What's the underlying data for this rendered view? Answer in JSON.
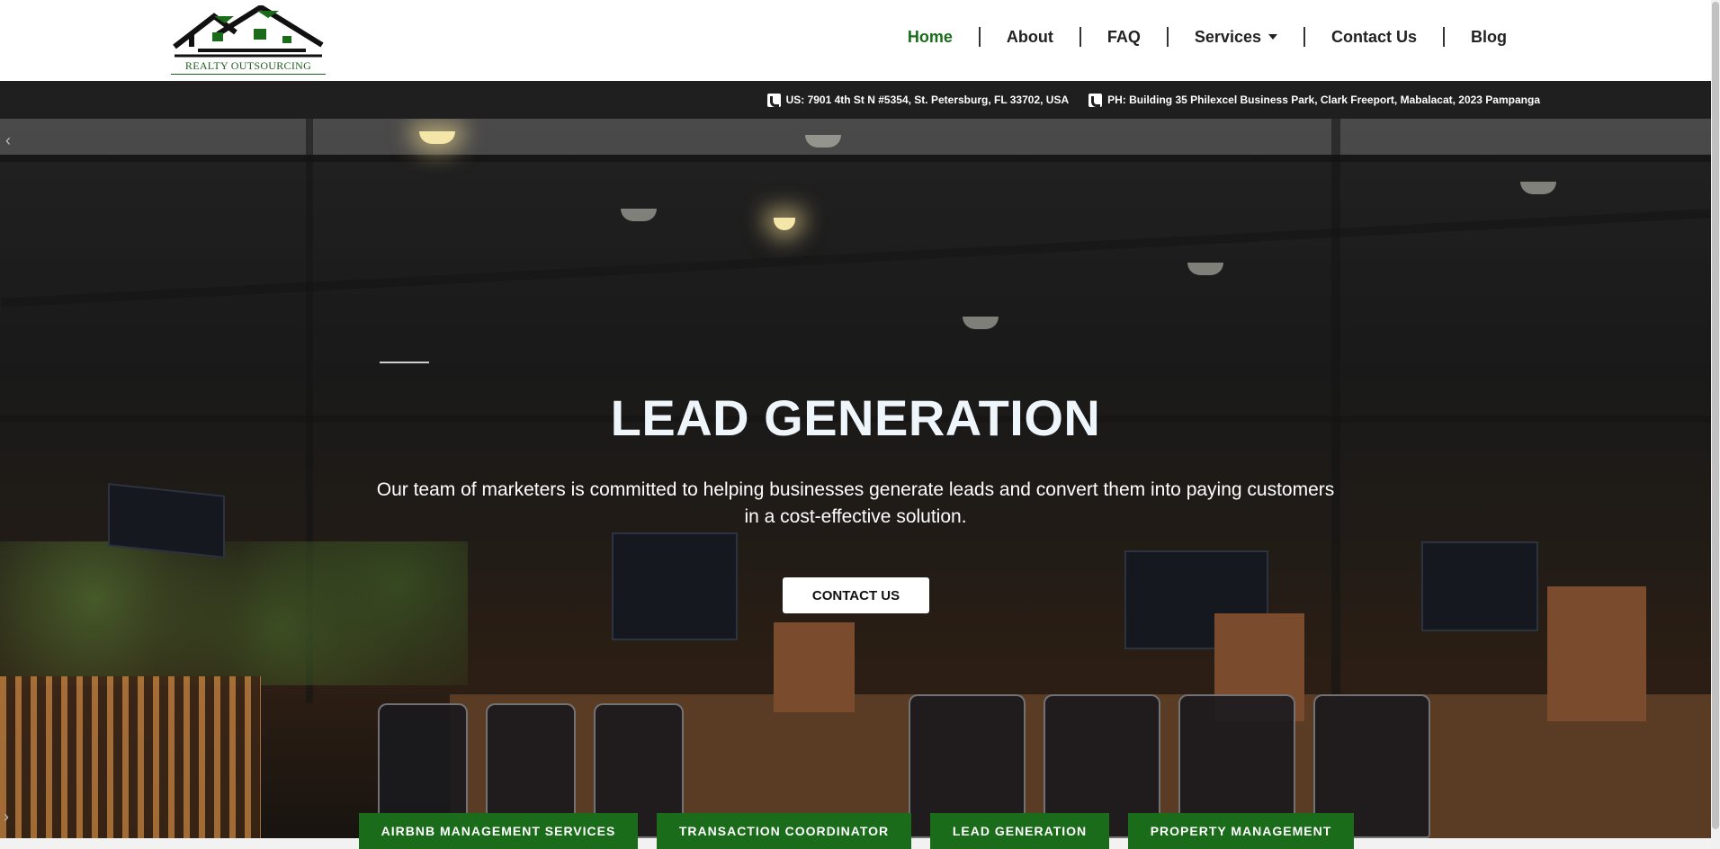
{
  "header": {
    "logo_text": "REALTY OUTSOURCING",
    "nav": [
      {
        "label": "Home",
        "active": true
      },
      {
        "label": "About",
        "active": false
      },
      {
        "label": "FAQ",
        "active": false
      },
      {
        "label": "Services",
        "active": false,
        "has_dropdown": true
      },
      {
        "label": "Contact Us",
        "active": false
      },
      {
        "label": "Blog",
        "active": false
      }
    ]
  },
  "infobar": {
    "us_address": "US: 7901 4th St N #5354, St. Petersburg, FL 33702, USA",
    "ph_address": "PH: Building 35 Philexcel Business Park, Clark Freeport, Mabalacat, 2023 Pampanga"
  },
  "hero": {
    "title": "LEAD GENERATION",
    "subtitle": "Our team of marketers is committed to helping businesses generate leads and convert them into paying customers in a cost-effective solution.",
    "cta_label": "CONTACT US"
  },
  "service_tabs": [
    "AIRBNB MANAGEMENT SERVICES",
    "TRANSACTION COORDINATOR",
    "LEAD GENERATION",
    "PROPERTY MANAGEMENT"
  ],
  "colors": {
    "brand_green": "#1a6b1a",
    "infobar_bg": "#1f1f1f",
    "nav_text": "#222222"
  },
  "icons": {
    "logo": "house-roofs-logo",
    "info_item": "phone-icon",
    "services_caret": "chevron-down-icon"
  }
}
